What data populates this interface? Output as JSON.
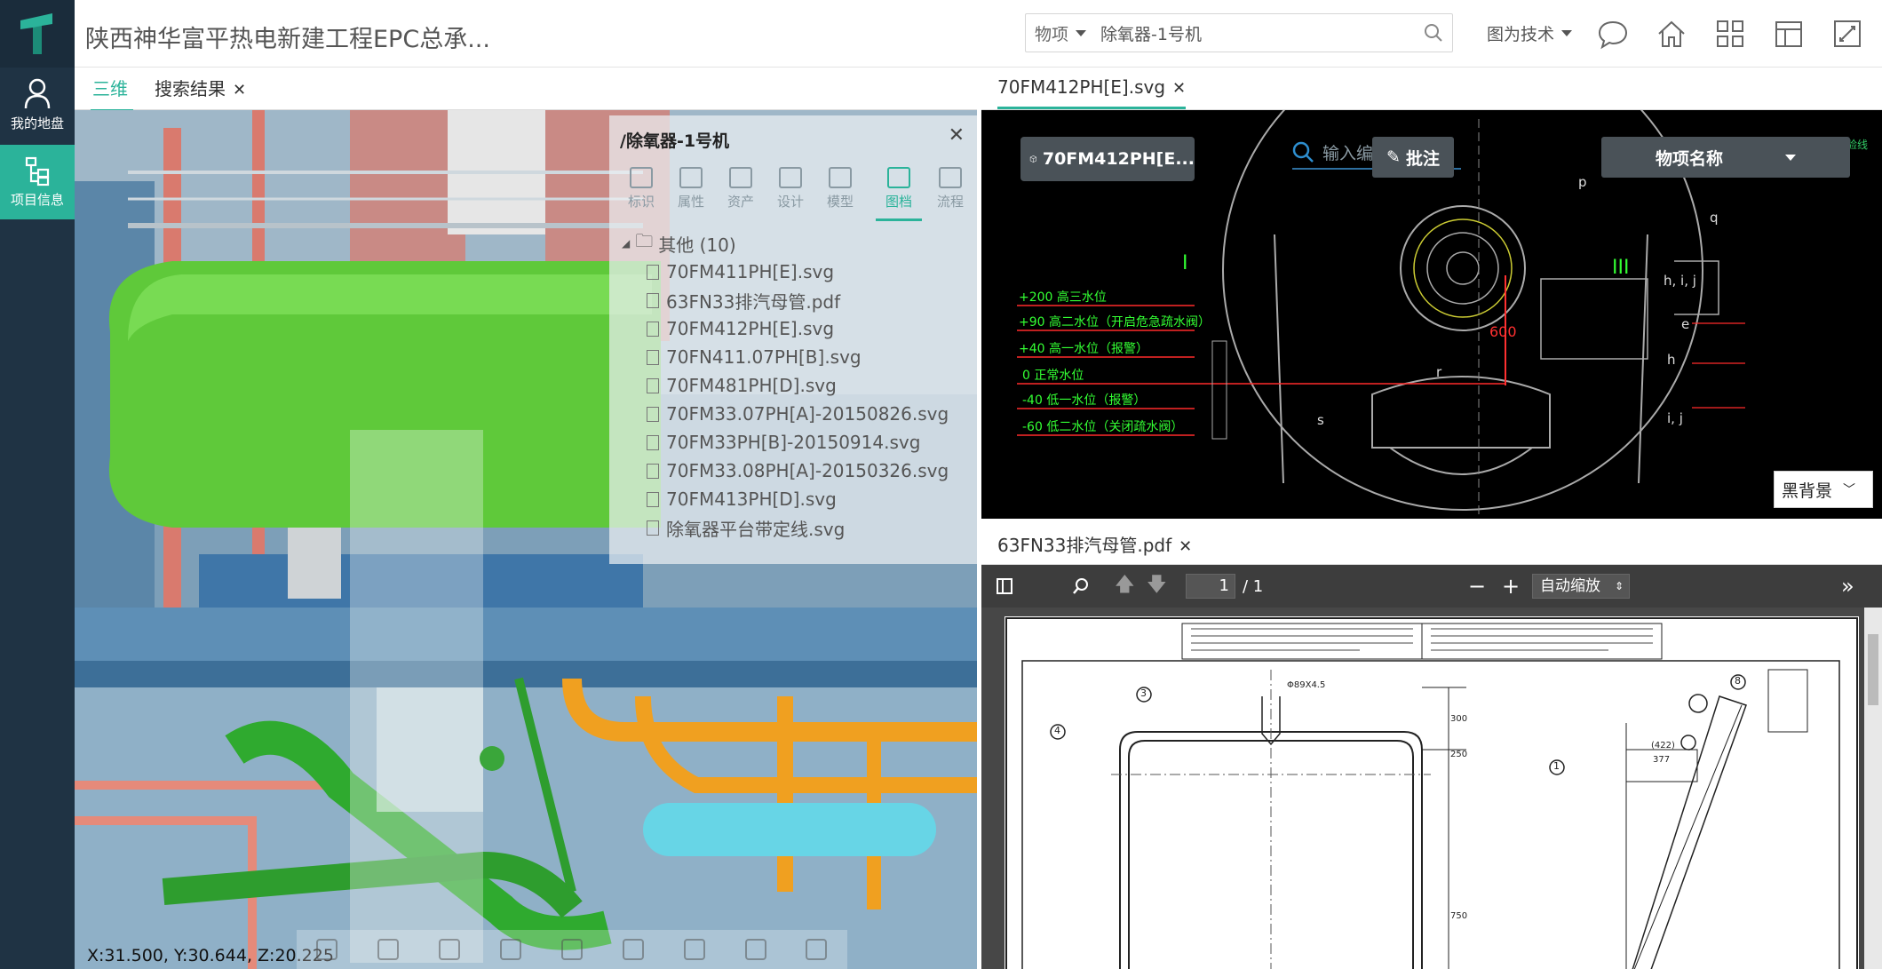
{
  "sidebar": {
    "items": [
      {
        "label": "我的地盘",
        "icon": "user-icon"
      },
      {
        "label": "项目信息",
        "icon": "project-tree-icon"
      }
    ]
  },
  "header": {
    "title": "陕西神华富平热电新建工程EPC总承...",
    "search": {
      "category": "物项",
      "value": "除氧器-1号机"
    },
    "view_select": "图为技术",
    "icons": [
      "chat-icon",
      "home-icon",
      "grid-icon",
      "layout-icon",
      "fullscreen-icon"
    ]
  },
  "left_pane": {
    "tabs": [
      {
        "label": "三维",
        "active": true
      },
      {
        "label": "搜索结果",
        "closable": true
      }
    ],
    "coordinates": "X:31.500, Y:30.644, Z:20.225",
    "overlay": {
      "title": "/除氧器-1号机",
      "tabs": [
        {
          "label": "标识",
          "icon": "tag-icon"
        },
        {
          "label": "属性",
          "icon": "properties-icon"
        },
        {
          "label": "资产",
          "icon": "asset-icon"
        },
        {
          "label": "设计",
          "icon": "design-icon"
        },
        {
          "label": "模型",
          "icon": "cube-icon"
        },
        {
          "label": "图档",
          "icon": "document-icon",
          "active": true
        },
        {
          "label": "流程",
          "icon": "flow-icon"
        }
      ],
      "folder": "其他 (10)",
      "files": [
        "70FM411PH[E].svg",
        "63FN33排汽母管.pdf",
        "70FM412PH[E].svg",
        "70FN411.07PH[B].svg",
        "70FM481PH[D].svg",
        "70FM33.07PH[A]-20150826.svg",
        "70FM33PH[B]-20150914.svg",
        "70FM33.08PH[A]-20150326.svg",
        "70FM413PH[D].svg",
        "除氧器平台带定线.svg"
      ]
    }
  },
  "right_top": {
    "tab": "70FM412PH[E].svg",
    "name_box": "70FM412PH[E...",
    "search_placeholder": "输入编",
    "annotate": "批注",
    "property_select": "物项名称",
    "corner_label": "工地试验线",
    "background_select": "黑背景",
    "water_levels": [
      "+200 高三水位",
      "+90 高二水位（开启危急疏水阀）",
      "+40 高一水位（报警）",
      "0 正常水位",
      "-40 低一水位（报警）",
      "-60 低二水位（关闭疏水阀）"
    ],
    "letters": [
      "p",
      "q",
      "h, i, j",
      "e",
      "h",
      "r",
      "s",
      "i, j"
    ],
    "roman": [
      "I",
      "III"
    ],
    "dimension": "600",
    "colors": {
      "level_text": "#33ff33",
      "level_line": "#ff2a2a",
      "lines": "#aaaaaa",
      "accent": "#2bb39a"
    }
  },
  "right_bottom": {
    "tab": "63FN33排汽母管.pdf",
    "toolbar": {
      "page": "1",
      "total": "/ 1",
      "zoom": "自动缩放"
    },
    "drawing": {
      "balloons": [
        "3",
        "4",
        "1",
        "8"
      ],
      "dims": [
        "Φ89X4.5",
        "300",
        "250",
        "750",
        "(422)",
        "377"
      ]
    }
  }
}
